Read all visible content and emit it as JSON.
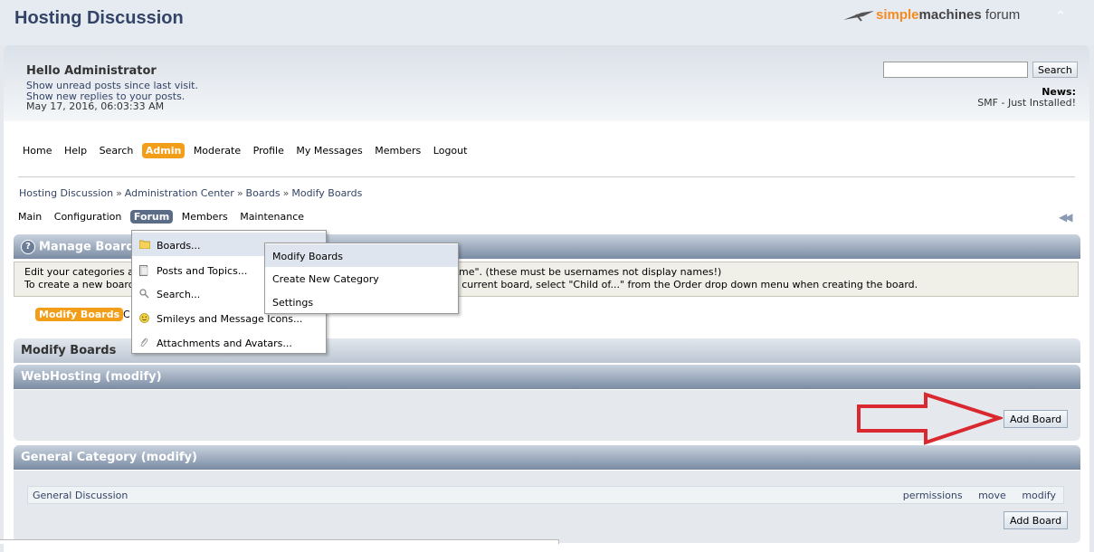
{
  "header": {
    "forum_title": "Hosting Discussion",
    "logo_simple": "simple",
    "logo_machines": "machines",
    "logo_forum": " forum"
  },
  "user": {
    "hello": "Hello Administrator",
    "unread": "Show unread posts since last visit.",
    "replies": "Show new replies to your posts.",
    "date": "May 17, 2016, 06:03:33 AM"
  },
  "search": {
    "value": "",
    "button": "Search"
  },
  "news": {
    "label": "News:",
    "text": "SMF - Just Installed!"
  },
  "main_nav": [
    "Home",
    "Help",
    "Search",
    "Admin",
    "Moderate",
    "Profile",
    "My Messages",
    "Members",
    "Logout"
  ],
  "main_nav_active": "Admin",
  "breadcrumb": [
    "Hosting Discussion",
    "Administration Center",
    "Boards",
    "Modify Boards"
  ],
  "sub_nav": [
    "Main",
    "Configuration",
    "Forum",
    "Members",
    "Maintenance"
  ],
  "sub_nav_active": "Forum",
  "forum_menu": {
    "items": [
      "Boards...",
      "Posts and Topics...",
      "Search...",
      "Smileys and Message Icons...",
      "Attachments and Avatars..."
    ],
    "hovered": "Boards..."
  },
  "boards_submenu": {
    "items": [
      "Modify Boards",
      "Create New Category",
      "Settings"
    ],
    "hovered": "Modify Boards"
  },
  "manage": {
    "title": "Manage Boards",
    "info_line1": "Edit your categories a",
    "info_line1_tail": "me\". (these must be usernames not display names!)",
    "info_line2": "To create a new board",
    "info_line2_tail": "a current board, select \"Child of...\" from the Order drop down menu when creating the board.",
    "tab_modify": "Modify Boards",
    "tab_c": "C"
  },
  "modify_boards_title": "Modify Boards",
  "categories": [
    {
      "name": "WebHosting (modify)",
      "add_board": "Add Board",
      "boards": []
    },
    {
      "name": "General Category (modify)",
      "add_board": "Add Board",
      "boards": [
        {
          "name": "General Discussion",
          "links": [
            "permissions",
            "move",
            "modify"
          ]
        }
      ]
    }
  ],
  "colors": {
    "accent": "#f29e18",
    "arrow": "#d9282f",
    "link": "#334466"
  },
  "icons": [
    "folder-icon",
    "document-icon",
    "magnifier-icon",
    "smiley-icon",
    "paperclip-icon",
    "help-icon",
    "collapse-icon",
    "double-left-arrow-icon"
  ]
}
